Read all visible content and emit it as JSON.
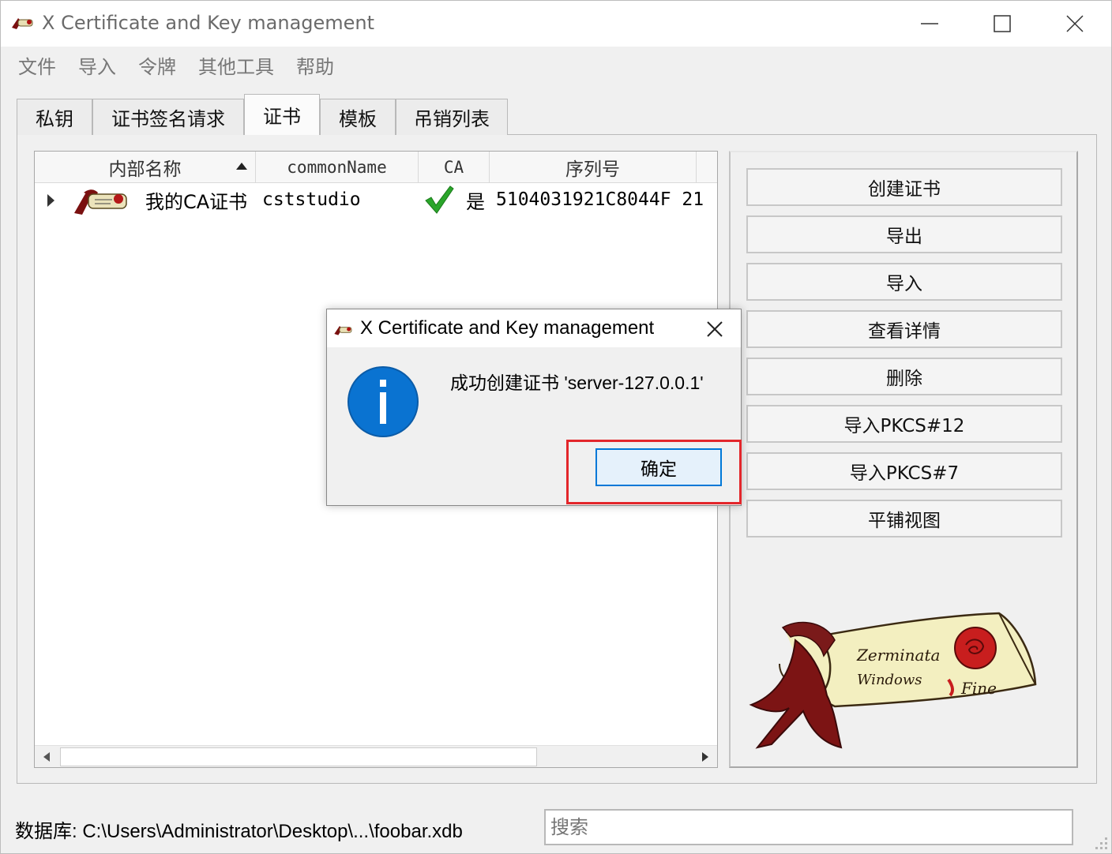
{
  "window": {
    "title": "X Certificate and Key management"
  },
  "menu": [
    "文件",
    "导入",
    "令牌",
    "其他工具",
    "帮助"
  ],
  "tabs": [
    "私钥",
    "证书签名请求",
    "证书",
    "模板",
    "吊销列表"
  ],
  "active_tab": "证书",
  "table": {
    "columns": [
      "内部名称",
      "commonName",
      "CA",
      "序列号"
    ],
    "rows": [
      {
        "name": "我的CA证书",
        "common_name": "cststudio",
        "ca": "是",
        "serial": "5104031921C8044F 21"
      }
    ]
  },
  "buttons": [
    "创建证书",
    "导出",
    "导入",
    "查看详情",
    "删除",
    "导入PKCS#12",
    "导入PKCS#7",
    "平铺视图"
  ],
  "status": {
    "database": "数据库: C:\\Users\\Administrator\\Desktop\\...\\foobar.xdb",
    "search_placeholder": "搜索"
  },
  "dialog": {
    "title": "X Certificate and Key management",
    "message": "成功创建证书 'server-127.0.0.1'",
    "ok_label": "确定"
  },
  "colors": {
    "accent": "#0078d7",
    "info": "#0a73d1",
    "highlight": "#e3262b",
    "check": "#2aa52a"
  }
}
